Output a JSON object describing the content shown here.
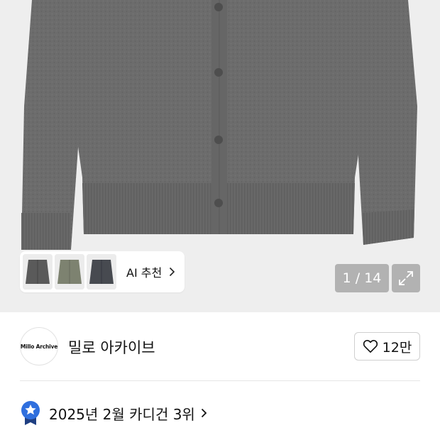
{
  "product_gallery": {
    "ai_recommend_label": "AI 추천",
    "counter_text": "1 / 14",
    "expand_icon": "expand-icon"
  },
  "brand": {
    "logo_text": "Millo Archive",
    "name": "밀로 아카이브",
    "like_count": "12만",
    "like_icon": "heart-outline-icon"
  },
  "ranking": {
    "text": "2025년 2월 카디건 3위",
    "icon": "star-medal-icon"
  },
  "colors": {
    "hero_background": "#eeeeee",
    "cardigan_gray": "#6b6b6b",
    "ranking_badge_blue": "#2f6fde"
  }
}
